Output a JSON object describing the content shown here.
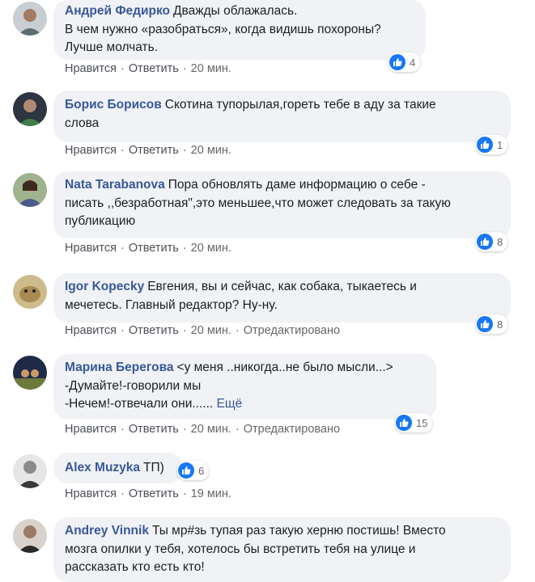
{
  "labels": {
    "like": "Нравится",
    "reply": "Ответить",
    "more": "Ещё"
  },
  "comments": [
    {
      "author": "Андрей Федирко",
      "text": "Дважды облажалась.\nВ чем нужно «разобраться», когда видишь похороны?\nЛучше молчать.",
      "time": "20 мин.",
      "edited": "",
      "likes": "4",
      "avatar": "#7a8a90"
    },
    {
      "author": "Борис Борисов",
      "text": "Скотина тупорылая,гореть тебе в аду за такие\nслова",
      "time": "20 мин.",
      "edited": "",
      "likes": "1",
      "avatar": "#3d4a55"
    },
    {
      "author": "Nata Tarabanova",
      "text": "Пора обновлять даме информацию о себе -\nписать ,,безработная\",это меньшее,что может следовать за такую\nпубликацию",
      "time": "20 мин.",
      "edited": "",
      "likes": "8",
      "avatar": "#8aa27a"
    },
    {
      "author": "Igor Kopecky",
      "text": "Евгения, вы и сейчас, как собака, тыкаетесь и\nмечетесь. Главный редактор? Ну-ну.",
      "time": "20 мин.",
      "edited": "Отредактировано",
      "likes": "8",
      "avatar": "#b8a278"
    },
    {
      "author": "Марина Берегова",
      "text": "<у меня ..никогда..не было мысли...>\n-Думайте!-говорили мы\n-Нечем!-отвечали они...... ",
      "time": "20 мин.",
      "edited": "Отредактировано",
      "likes": "15",
      "avatar": "#2e3a58"
    },
    {
      "author": "Alex Muzyka",
      "text": "ТП)",
      "time": "19 мин.",
      "edited": "",
      "likes": "6",
      "avatar": "#5a5a5a"
    },
    {
      "author": "Andrey Vinnik",
      "text": "Ты мр#зь тупая раз такую херню постишь! Вместо\nмозга опилки у тебя, хотелось бы встретить тебя на улице и\nрассказать кто есть кто!",
      "time": "",
      "edited": "",
      "likes": "",
      "avatar": "#6a5a52"
    }
  ]
}
